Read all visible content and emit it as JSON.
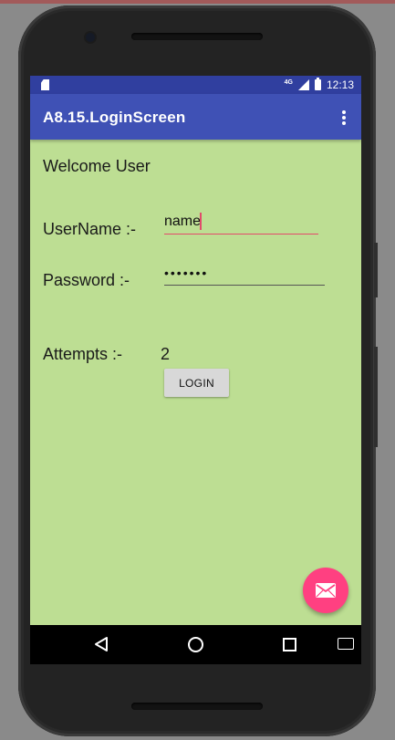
{
  "status_bar": {
    "network": "4G",
    "time": "12:13"
  },
  "app_bar": {
    "title": "A8.15.LoginScreen"
  },
  "form": {
    "welcome_text": "Welcome User",
    "username_label": "UserName :-",
    "username_value": "name",
    "password_label": "Password :-",
    "password_value": "•••••••",
    "attempts_label": "Attempts :-",
    "attempts_value": "2",
    "login_button": "LOGIN"
  },
  "fab": {
    "icon": "email-icon"
  },
  "colors": {
    "status_bar": "#303f9f",
    "app_bar": "#3f51b5",
    "background": "#bdde93",
    "accent": "#ff4081"
  }
}
